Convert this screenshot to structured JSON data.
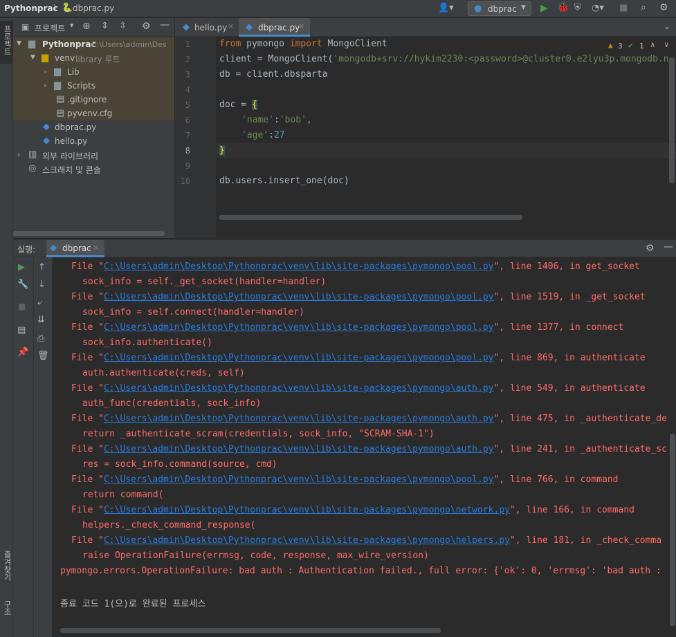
{
  "navbar": {
    "project_name": "Pythonprac",
    "file_name": "dbprac.py",
    "run_config": "dbprac"
  },
  "left_strip": {
    "top_label": "프로젝트",
    "mid_label": "즐겨찾기",
    "bottom_label": "구조"
  },
  "project_panel": {
    "title": "프로젝트",
    "tree": [
      {
        "label": "Pythonprac",
        "suffix": "C:\\Users\\admin\\Des"
      },
      {
        "label": "venv",
        "suffix": "library 루트"
      },
      {
        "label": "Lib"
      },
      {
        "label": "Scripts"
      },
      {
        "label": ".gitignore"
      },
      {
        "label": "pyvenv.cfg"
      },
      {
        "label": "dbprac.py"
      },
      {
        "label": "hello.py"
      },
      {
        "label": "외부 라이브러리"
      },
      {
        "label": "스크래치 및 콘솔"
      }
    ]
  },
  "editor": {
    "tabs": [
      {
        "label": "hello.py"
      },
      {
        "label": "dbprac.py"
      }
    ],
    "inspections": {
      "warnings": "3",
      "ok": "1"
    },
    "line_numbers": [
      "1",
      "2",
      "3",
      "4",
      "5",
      "6",
      "7",
      "8",
      "9",
      "10"
    ],
    "code": {
      "l1_kw1": "from",
      "l1_mod": " pymongo ",
      "l1_kw2": "import",
      "l1_cls": " MongoClient",
      "l2_a": "client = MongoClient(",
      "l2_str": "'mongodb+srv://hykim2230:<password>@cluster0.e2lyu3p.mongodb.n",
      "l3": "db = client.dbsparta",
      "l5_a": "doc = ",
      "l5_brace": "{",
      "l6_key": "'name'",
      "l6_colon": ":",
      "l6_val": "'bob'",
      "l6_comma": ",",
      "l7_key": "'age'",
      "l7_colon": ":",
      "l7_val": "27",
      "l8_brace": "}",
      "l10": "db.users.insert_one(doc)"
    }
  },
  "run_panel": {
    "label": "실행:",
    "tab": "dbprac",
    "file_prefix": "File \"",
    "traceback": [
      {
        "path": "C:\\Users\\admin\\Desktop\\Pythonprac\\venv\\lib\\site-packages\\pymongo\\pool.py",
        "rest": "\", line 1406, in get_socket",
        "code": "sock_info = self._get_socket(handler=handler)"
      },
      {
        "path": "C:\\Users\\admin\\Desktop\\Pythonprac\\venv\\lib\\site-packages\\pymongo\\pool.py",
        "rest": "\", line 1519, in _get_socket",
        "code": "sock_info = self.connect(handler=handler)"
      },
      {
        "path": "C:\\Users\\admin\\Desktop\\Pythonprac\\venv\\lib\\site-packages\\pymongo\\pool.py",
        "rest": "\", line 1377, in connect",
        "code": "sock_info.authenticate()"
      },
      {
        "path": "C:\\Users\\admin\\Desktop\\Pythonprac\\venv\\lib\\site-packages\\pymongo\\pool.py",
        "rest": "\", line 869, in authenticate",
        "code": "auth.authenticate(creds, self)"
      },
      {
        "path": "C:\\Users\\admin\\Desktop\\Pythonprac\\venv\\lib\\site-packages\\pymongo\\auth.py",
        "rest": "\", line 549, in authenticate",
        "code": "auth_func(credentials, sock_info)"
      },
      {
        "path": "C:\\Users\\admin\\Desktop\\Pythonprac\\venv\\lib\\site-packages\\pymongo\\auth.py",
        "rest": "\", line 475, in _authenticate_de",
        "code": "return _authenticate_scram(credentials, sock_info, \"SCRAM-SHA-1\")"
      },
      {
        "path": "C:\\Users\\admin\\Desktop\\Pythonprac\\venv\\lib\\site-packages\\pymongo\\auth.py",
        "rest": "\", line 241, in _authenticate_sc",
        "code": "res = sock_info.command(source, cmd)"
      },
      {
        "path": "C:\\Users\\admin\\Desktop\\Pythonprac\\venv\\lib\\site-packages\\pymongo\\pool.py",
        "rest": "\", line 766, in command",
        "code": "return command("
      },
      {
        "path": "C:\\Users\\admin\\Desktop\\Pythonprac\\venv\\lib\\site-packages\\pymongo\\network.py",
        "rest": "\", line 166, in command",
        "code": "helpers._check_command_response("
      },
      {
        "path": "C:\\Users\\admin\\Desktop\\Pythonprac\\venv\\lib\\site-packages\\pymongo\\helpers.py",
        "rest": "\", line 181, in _check_comma",
        "code": "raise OperationFailure(errmsg, code, response, max_wire_version)"
      }
    ],
    "error_line": "pymongo.errors.OperationFailure: bad auth : Authentication failed., full error: {'ok': 0, 'errmsg': 'bad auth :",
    "exit_line": "종료 코드 1(으)로 완료된 프로세스"
  },
  "colors": {
    "error": "#ff6b68",
    "link": "#287bde",
    "accent": "#4a88c7"
  }
}
